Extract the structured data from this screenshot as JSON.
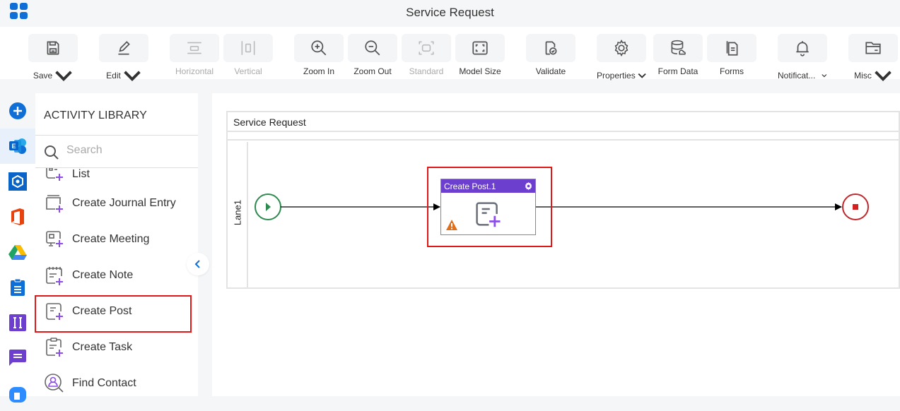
{
  "app": {
    "title": "Service Request",
    "menu_icon": "app-grid-icon"
  },
  "toolbar": {
    "buttons": [
      {
        "id": "save",
        "label": "Save",
        "icon": "save-icon",
        "dropdown": true,
        "disabled": false
      },
      {
        "id": "edit",
        "label": "Edit",
        "icon": "pencil-icon",
        "dropdown": true,
        "disabled": false
      },
      {
        "id": "horizontal",
        "label": "Horizontal",
        "icon": "horizontal-layout-icon",
        "dropdown": false,
        "disabled": true
      },
      {
        "id": "vertical",
        "label": "Vertical",
        "icon": "vertical-layout-icon",
        "dropdown": false,
        "disabled": true
      },
      {
        "id": "zoom-in",
        "label": "Zoom In",
        "icon": "zoom-in-icon",
        "dropdown": false,
        "disabled": false
      },
      {
        "id": "zoom-out",
        "label": "Zoom Out",
        "icon": "zoom-out-icon",
        "dropdown": false,
        "disabled": false
      },
      {
        "id": "standard",
        "label": "Standard",
        "icon": "standard-size-icon",
        "dropdown": false,
        "disabled": true
      },
      {
        "id": "model-size",
        "label": "Model Size",
        "icon": "fit-screen-icon",
        "dropdown": false,
        "disabled": false
      },
      {
        "id": "validate",
        "label": "Validate",
        "icon": "validate-icon",
        "dropdown": false,
        "disabled": false
      },
      {
        "id": "properties",
        "label": "Properties",
        "icon": "gear-icon",
        "dropdown": true,
        "disabled": false
      },
      {
        "id": "form-data",
        "label": "Form Data",
        "icon": "database-icon",
        "dropdown": false,
        "disabled": false
      },
      {
        "id": "forms",
        "label": "Forms",
        "icon": "forms-icon",
        "dropdown": false,
        "disabled": false
      },
      {
        "id": "notifications",
        "label": "Notificat...",
        "icon": "bell-icon",
        "dropdown": true,
        "disabled": false
      },
      {
        "id": "misc",
        "label": "Misc",
        "icon": "folder-icon",
        "dropdown": true,
        "disabled": false
      }
    ]
  },
  "rail": {
    "items": [
      {
        "name": "add",
        "icon": "add-circle-icon",
        "active": false
      },
      {
        "name": "exchange",
        "icon": "exchange-icon",
        "active": true
      },
      {
        "name": "azure",
        "icon": "hexagon-app-icon",
        "active": false
      },
      {
        "name": "office",
        "icon": "office-icon",
        "active": false
      },
      {
        "name": "google-drive",
        "icon": "google-drive-icon",
        "active": false
      },
      {
        "name": "clipboard",
        "icon": "clipboard-icon",
        "active": false
      },
      {
        "name": "integration",
        "icon": "i-beam-icon",
        "active": false
      },
      {
        "name": "chat",
        "icon": "chat-icon",
        "active": false
      },
      {
        "name": "video",
        "icon": "video-icon",
        "active": false
      }
    ]
  },
  "library": {
    "title": "ACTIVITY LIBRARY",
    "search_placeholder": "Search",
    "items": [
      {
        "label": "List",
        "icon": "create-list-icon"
      },
      {
        "label": "Create Journal Entry",
        "icon": "journal-entry-icon"
      },
      {
        "label": "Create Meeting",
        "icon": "meeting-icon"
      },
      {
        "label": "Create Note",
        "icon": "note-icon"
      },
      {
        "label": "Create Post",
        "icon": "post-icon",
        "highlighted": true
      },
      {
        "label": "Create Task",
        "icon": "task-icon"
      },
      {
        "label": "Find Contact",
        "icon": "find-contact-icon"
      }
    ],
    "collapse_icon": "chevron-left-icon"
  },
  "canvas": {
    "pool_title": "Service Request",
    "lane_label": "Lane1",
    "task": {
      "title": "Create Post.1",
      "warning": true
    },
    "colors": {
      "task_header": "#6d3fcf",
      "start_event": "#2e8b4f",
      "end_event": "#c0282d",
      "highlight": "#e01818",
      "warning": "#e0701b"
    }
  }
}
